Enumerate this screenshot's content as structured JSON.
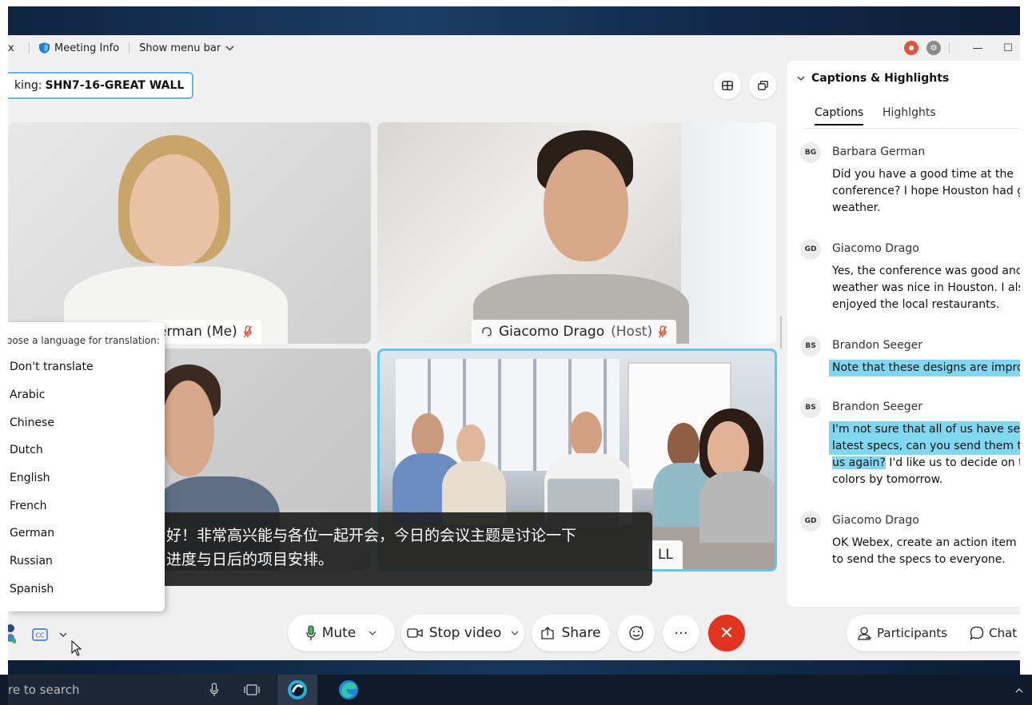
{
  "titlebar": {
    "app_fragment": "x",
    "meeting_info": "Meeting Info",
    "show_menu_bar": "Show menu bar",
    "minimize": "—",
    "maximize": "☐"
  },
  "speaking": {
    "prefix": "king:",
    "name": "SHN7-16-GREAT WALL"
  },
  "tiles": [
    {
      "name": "erman (Me)"
    },
    {
      "name": "Giacomo Drago",
      "role": "(Host)"
    },
    {
      "name": ""
    },
    {
      "name": "LL"
    }
  ],
  "language_menu": {
    "title": "oose a language for translation:",
    "options": [
      "Don't translate",
      "Arabic",
      "Chinese",
      "Dutch",
      "English",
      "French",
      "German",
      "Russian",
      "Spanish"
    ]
  },
  "caption_overlay": {
    "line1": "好！非常高兴能与各位一起开会，今日的会议主题是讨论一下",
    "line2": "进度与日后的项目安排。"
  },
  "sidebar": {
    "title": "Captions & Highlights",
    "tabs": [
      "Captions",
      "Highlghts"
    ],
    "entries": [
      {
        "initials": "BG",
        "name": "Barbara German",
        "lines": [
          "Did you have a good time at the",
          "conference? I hope Houston had go",
          "weather."
        ]
      },
      {
        "initials": "GD",
        "name": "Giacomo Drago",
        "lines": [
          "Yes, the conference was good and t",
          "weather was nice in Houston. I also",
          "enjoyed the local restaurants."
        ]
      },
      {
        "initials": "BS",
        "name": "Brandon Seeger",
        "lines": [
          "Note that these designs are improv"
        ]
      },
      {
        "initials": "BS",
        "name": "Brandon Seeger",
        "lines": [
          "I'm not sure that all of us have seen",
          "latest specs, can you send them to a",
          "us again?",
          " I'd like us to decide on th",
          "colors by tomorrow."
        ]
      },
      {
        "initials": "GD",
        "name": "Giacomo Drago",
        "lines": [
          "OK Webex, create an action item fo",
          "to send the specs to everyone."
        ]
      }
    ]
  },
  "controls": {
    "mute": "Mute",
    "stop_video": "Stop video",
    "share": "Share",
    "more": "···",
    "end": "✕",
    "participants": "Participants",
    "chat": "Chat"
  },
  "taskbar": {
    "search": "re to search"
  },
  "colors": {
    "accent_blue": "#5fb6ea",
    "highlight": "#7fd7f0",
    "end_red": "#e0341f",
    "record_red": "#e2553d"
  }
}
